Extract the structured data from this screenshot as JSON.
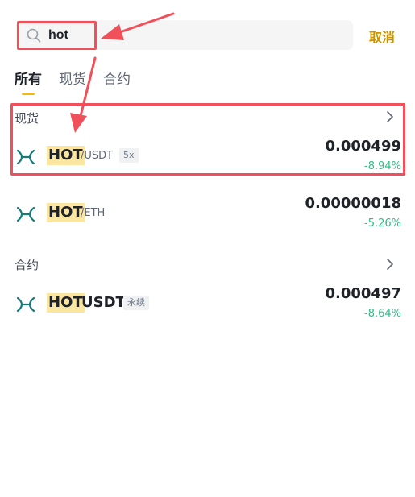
{
  "search": {
    "value": "hot",
    "cancel_label": "取消"
  },
  "tabs": [
    {
      "label": "所有",
      "active": true
    },
    {
      "label": "现货",
      "active": false
    },
    {
      "label": "合约",
      "active": false
    }
  ],
  "sections": {
    "spot": {
      "title": "现货"
    },
    "contract": {
      "title": "合约"
    }
  },
  "rows": {
    "hot_usdt": {
      "base": "HOT",
      "quote": "/USDT",
      "badge": "5x",
      "price": "0.000499",
      "change": "-8.94%"
    },
    "hot_eth": {
      "base": "HOT",
      "quote": "/ETH",
      "price": "0.00000018",
      "change": "-5.26%"
    },
    "hot_usdt_perp": {
      "base": "HOT",
      "quote": "USDT",
      "badge": "永续",
      "price": "0.000497",
      "change": "-8.64%"
    }
  },
  "colors": {
    "accent": "#f0b90b",
    "cancel": "#c99400",
    "negative_change": "#2ebd85",
    "annotation": "#f0505a",
    "logo": "#177a7a"
  },
  "icons": {
    "search": "search-icon",
    "chevron": "chevron-right-icon",
    "coin_logo": "holo-logo-icon"
  }
}
